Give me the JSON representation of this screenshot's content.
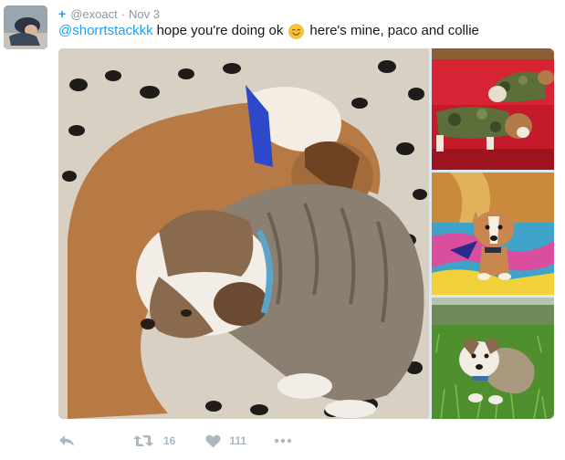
{
  "header": {
    "follow_symbol": "+",
    "handle": "@exoact",
    "separator": "·",
    "date": "Nov 3"
  },
  "tweet": {
    "mention": "@shorrtstackkk",
    "text_before_emoji": "hope you're doing ok",
    "emoji": "smiling-face-with-smiling-eyes",
    "text_after_emoji": "here's mine, paco and collie"
  },
  "media": {
    "photos": [
      {
        "subject": "two puppies curled up sleeping on a leopard-print bed"
      },
      {
        "subject": "two puppies in camo sweaters on a red couch"
      },
      {
        "subject": "puppy standing on a colorful blanket"
      },
      {
        "subject": "puppy sitting in green grass"
      }
    ]
  },
  "actions": {
    "reply_icon": "reply-icon",
    "retweet_icon": "retweet-icon",
    "retweet_count": "16",
    "like_icon": "heart-icon",
    "like_count": "111",
    "more_icon": "more-icon"
  },
  "colors": {
    "link": "#1da1f2",
    "muted": "#8899a6",
    "action_gray": "#aab8c2",
    "text": "#14171a"
  }
}
